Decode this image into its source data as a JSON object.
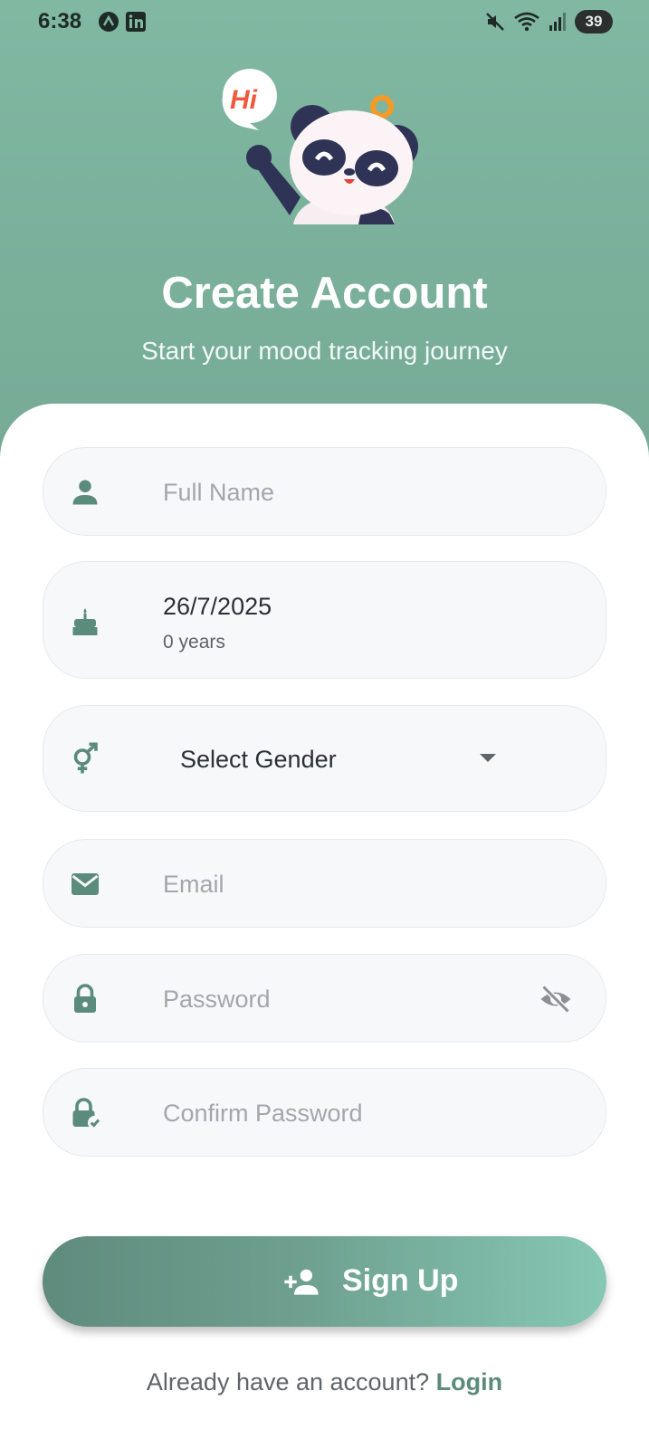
{
  "status_bar": {
    "time": "6:38",
    "battery": "39"
  },
  "mascot": {
    "bubble_text": "Hi"
  },
  "header": {
    "title": "Create Account",
    "subtitle": "Start your mood tracking journey"
  },
  "form": {
    "full_name": {
      "placeholder": "Full Name",
      "value": ""
    },
    "birthdate": {
      "value": "26/7/2025",
      "age": "0 years"
    },
    "gender": {
      "selected": "Select Gender"
    },
    "email": {
      "placeholder": "Email",
      "value": ""
    },
    "password": {
      "placeholder": "Password",
      "value": ""
    },
    "confirm_password": {
      "placeholder": "Confirm Password",
      "value": ""
    }
  },
  "signup_button": {
    "label": "Sign Up"
  },
  "footer": {
    "prompt": "Already have an account?",
    "login_label": "Login"
  },
  "colors": {
    "header_bg": "#7bb39d",
    "accent": "#5b8b7b",
    "field_bg": "#f7f8fa",
    "icon": "#5b8b7b"
  },
  "icons": {
    "status_apps": [
      "a-app-icon",
      "linkedin-icon"
    ],
    "status_right": [
      "mute-icon",
      "wifi-icon",
      "signal-icon",
      "battery-icon"
    ],
    "fields": [
      "person-icon",
      "cake-icon",
      "gender-icon",
      "mail-icon",
      "lock-icon",
      "lock-check-icon"
    ],
    "visibility": "visibility-off-icon",
    "dropdown": "dropdown-arrow-icon",
    "signup": "person-add-icon"
  }
}
